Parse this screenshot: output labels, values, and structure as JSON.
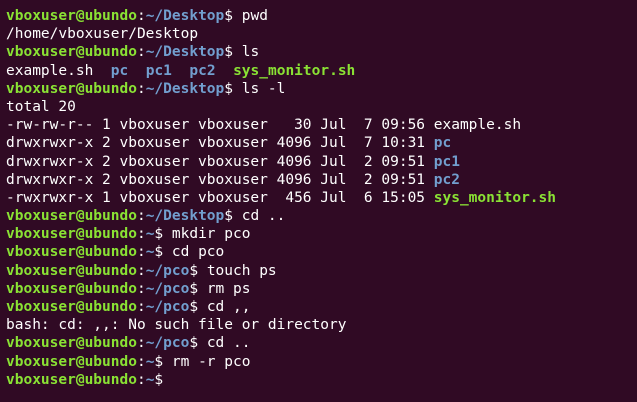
{
  "terminal": {
    "lines": [
      {
        "type": "prompt",
        "user": "vboxuser@ubundo",
        "path": "~/Desktop",
        "command": "pwd"
      },
      {
        "type": "output",
        "segments": [
          {
            "text": "/home/vboxuser/Desktop",
            "style": "plain"
          }
        ]
      },
      {
        "type": "prompt",
        "user": "vboxuser@ubundo",
        "path": "~/Desktop",
        "command": "ls"
      },
      {
        "type": "output",
        "segments": [
          {
            "text": "example.sh",
            "style": "plain"
          },
          {
            "text": "  ",
            "style": "plain"
          },
          {
            "text": "pc",
            "style": "dir"
          },
          {
            "text": "  ",
            "style": "plain"
          },
          {
            "text": "pc1",
            "style": "dir"
          },
          {
            "text": "  ",
            "style": "plain"
          },
          {
            "text": "pc2",
            "style": "dir"
          },
          {
            "text": "  ",
            "style": "plain"
          },
          {
            "text": "sys_monitor.sh",
            "style": "exec"
          }
        ]
      },
      {
        "type": "prompt",
        "user": "vboxuser@ubundo",
        "path": "~/Desktop",
        "command": "ls -l"
      },
      {
        "type": "output",
        "segments": [
          {
            "text": "total 20",
            "style": "plain"
          }
        ]
      },
      {
        "type": "output",
        "segments": [
          {
            "text": "-rw-rw-r-- 1 vboxuser vboxuser   30 Jul  7 09:56 ",
            "style": "plain"
          },
          {
            "text": "example.sh",
            "style": "plain"
          }
        ]
      },
      {
        "type": "output",
        "segments": [
          {
            "text": "drwxrwxr-x 2 vboxuser vboxuser 4096 Jul  7 10:31 ",
            "style": "plain"
          },
          {
            "text": "pc",
            "style": "dir"
          }
        ]
      },
      {
        "type": "output",
        "segments": [
          {
            "text": "drwxrwxr-x 2 vboxuser vboxuser 4096 Jul  2 09:51 ",
            "style": "plain"
          },
          {
            "text": "pc1",
            "style": "dir"
          }
        ]
      },
      {
        "type": "output",
        "segments": [
          {
            "text": "drwxrwxr-x 2 vboxuser vboxuser 4096 Jul  2 09:51 ",
            "style": "plain"
          },
          {
            "text": "pc2",
            "style": "dir"
          }
        ]
      },
      {
        "type": "output",
        "segments": [
          {
            "text": "-rwxrwxr-x 1 vboxuser vboxuser  456 Jul  6 15:05 ",
            "style": "plain"
          },
          {
            "text": "sys_monitor.sh",
            "style": "exec"
          }
        ]
      },
      {
        "type": "prompt",
        "user": "vboxuser@ubundo",
        "path": "~/Desktop",
        "command": "cd .."
      },
      {
        "type": "prompt",
        "user": "vboxuser@ubundo",
        "path": "~",
        "command": "mkdir pco"
      },
      {
        "type": "prompt",
        "user": "vboxuser@ubundo",
        "path": "~",
        "command": "cd pco"
      },
      {
        "type": "prompt",
        "user": "vboxuser@ubundo",
        "path": "~/pco",
        "command": "touch ps"
      },
      {
        "type": "prompt",
        "user": "vboxuser@ubundo",
        "path": "~/pco",
        "command": "rm ps"
      },
      {
        "type": "prompt",
        "user": "vboxuser@ubundo",
        "path": "~/pco",
        "command": "cd ,,"
      },
      {
        "type": "output",
        "segments": [
          {
            "text": "bash: cd: ,,: No such file or directory",
            "style": "plain"
          }
        ]
      },
      {
        "type": "prompt",
        "user": "vboxuser@ubundo",
        "path": "~/pco",
        "command": "cd .."
      },
      {
        "type": "prompt",
        "user": "vboxuser@ubundo",
        "path": "~",
        "command": "rm -r pco"
      },
      {
        "type": "prompt",
        "user": "vboxuser@ubundo",
        "path": "~",
        "command": ""
      }
    ]
  },
  "colors": {
    "background": "#300a24",
    "user": "#8ae234",
    "path": "#729fcf",
    "text": "#ffffff"
  }
}
